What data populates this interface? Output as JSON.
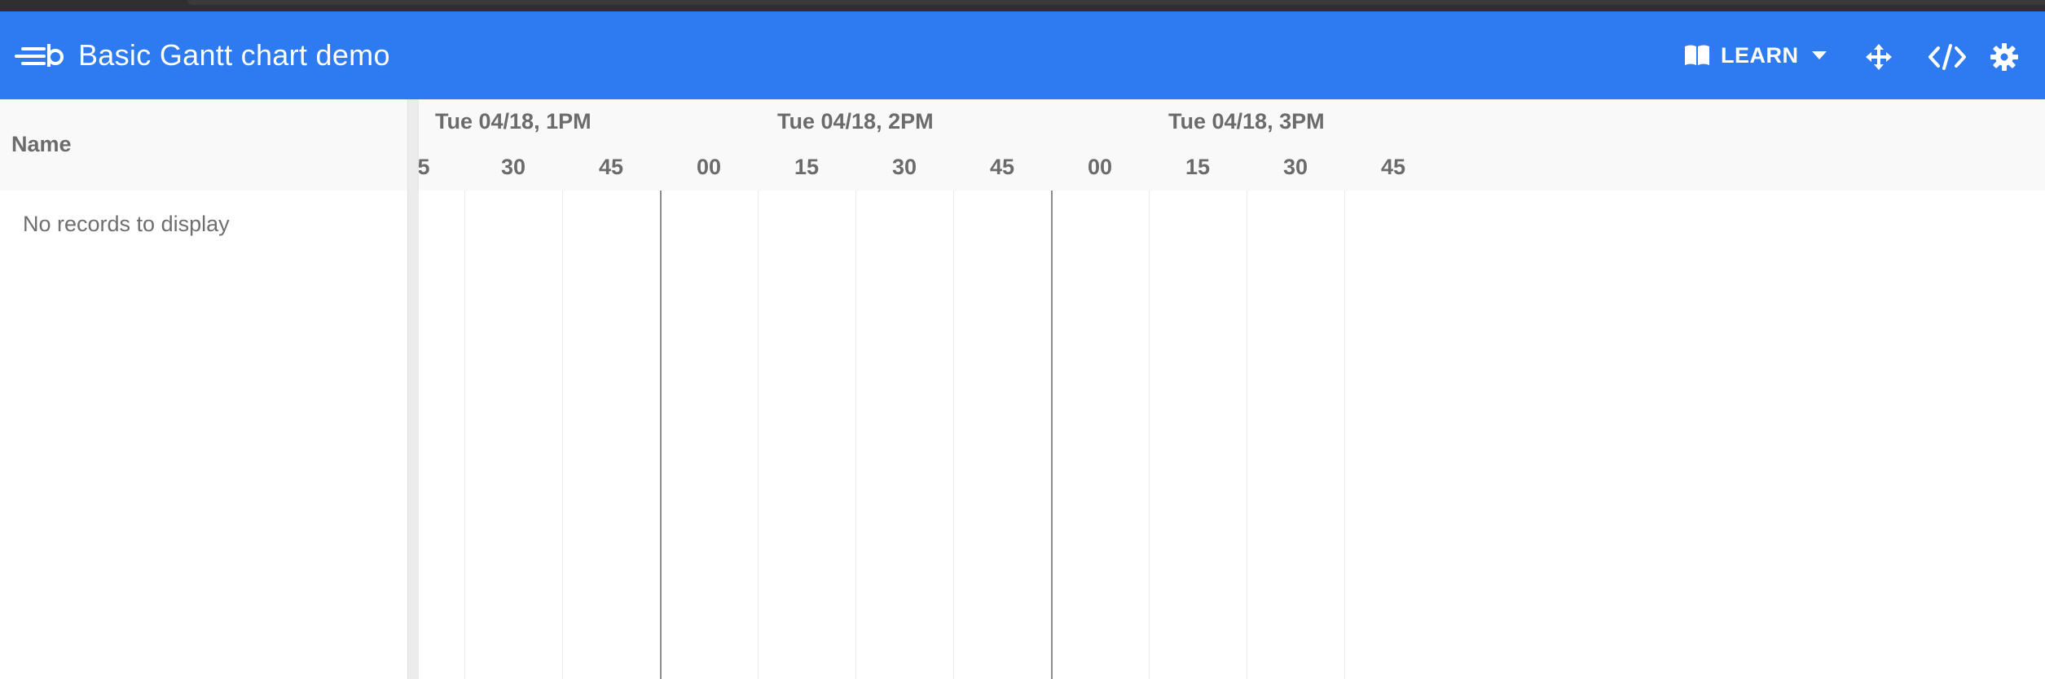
{
  "app": {
    "title": "Basic Gantt chart demo",
    "accent_color": "#2d7af1",
    "logo_icon": "bryntum-logo-icon"
  },
  "header_tools": {
    "learn_label": "LEARN",
    "learn_icon": "book-icon",
    "learn_caret_icon": "caret-down-icon",
    "fullscreen_icon": "move-arrows-icon",
    "code_icon": "code-icon",
    "settings_icon": "gear-icon"
  },
  "grid": {
    "name_column_header": "Name",
    "empty_text": "No records to display"
  },
  "timeline": {
    "hour_labels": [
      "Tue 04/18, 1PM",
      "Tue 04/18, 2PM",
      "Tue 04/18, 3PM"
    ],
    "minute_labels": [
      "5",
      "30",
      "45",
      "00",
      "15",
      "30",
      "45",
      "00",
      "15",
      "30",
      "45"
    ]
  }
}
